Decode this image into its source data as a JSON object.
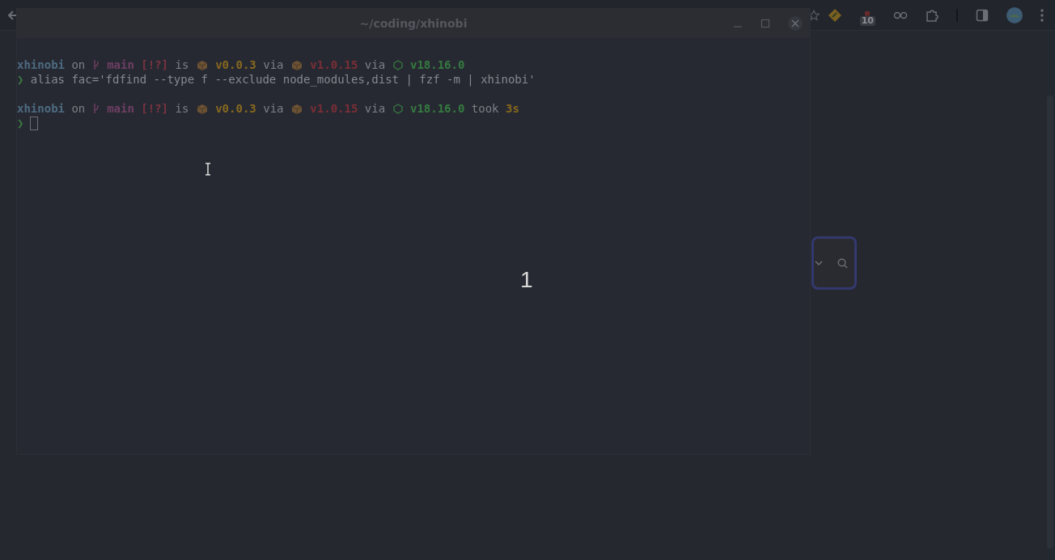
{
  "browser": {
    "extension_badge": "10"
  },
  "terminal": {
    "title": "~/coding/xhinobi",
    "lines": [
      {
        "kind": "status",
        "segments": [
          {
            "kind": "dir",
            "text": "xhinobi"
          },
          {
            "kind": "plain",
            "text": " on "
          },
          {
            "kind": "branch-icon"
          },
          {
            "kind": "branch",
            "text": " main"
          },
          {
            "kind": "status",
            "text": " [!?]"
          },
          {
            "kind": "plain",
            "text": " is "
          },
          {
            "kind": "package-icon"
          },
          {
            "kind": "pkgver",
            "text": " v0.0.3"
          },
          {
            "kind": "plain",
            "text": " via "
          },
          {
            "kind": "package-icon"
          },
          {
            "kind": "rust",
            "text": " v1.0.15"
          },
          {
            "kind": "plain",
            "text": " via "
          },
          {
            "kind": "node-icon"
          },
          {
            "kind": "node",
            "text": " v18.16.0"
          }
        ]
      },
      {
        "kind": "input",
        "segments": [
          {
            "kind": "prompt",
            "text": "❯"
          },
          {
            "kind": "command",
            "text": " alias fac='fdfind --type f --exclude node_modules,dist | fzf -m | xhinobi'"
          }
        ]
      },
      {
        "kind": "status",
        "segments": [
          {
            "kind": "dir",
            "text": "xhinobi"
          },
          {
            "kind": "plain",
            "text": " on "
          },
          {
            "kind": "branch-icon"
          },
          {
            "kind": "branch",
            "text": " main"
          },
          {
            "kind": "status",
            "text": " [!?]"
          },
          {
            "kind": "plain",
            "text": " is "
          },
          {
            "kind": "package-icon"
          },
          {
            "kind": "pkgver",
            "text": " v0.0.3"
          },
          {
            "kind": "plain",
            "text": " via "
          },
          {
            "kind": "package-icon"
          },
          {
            "kind": "rust",
            "text": " v1.0.15"
          },
          {
            "kind": "plain",
            "text": " via "
          },
          {
            "kind": "node-icon"
          },
          {
            "kind": "node",
            "text": " v18.16.0"
          },
          {
            "kind": "plain",
            "text": " took "
          },
          {
            "kind": "duration",
            "text": "3s"
          }
        ]
      },
      {
        "kind": "input",
        "segments": [
          {
            "kind": "prompt",
            "text": "❯"
          },
          {
            "kind": "cursor"
          }
        ]
      }
    ]
  },
  "overlay_number": "1"
}
